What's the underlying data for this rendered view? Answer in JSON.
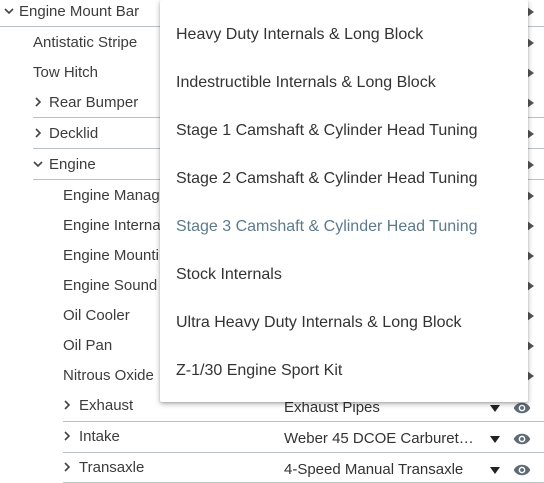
{
  "tree": {
    "rows": [
      {
        "label": "Engine Mount Bar"
      },
      {
        "label": "Antistatic Stripe"
      },
      {
        "label": "Tow Hitch"
      },
      {
        "label": "Rear Bumper"
      },
      {
        "label": "Decklid"
      },
      {
        "label": "Engine"
      },
      {
        "label": "Engine Manag"
      },
      {
        "label": "Engine Interna"
      },
      {
        "label": "Engine Mounti"
      },
      {
        "label": "Engine Sound"
      },
      {
        "label": "Oil Cooler"
      },
      {
        "label": "Oil Pan"
      },
      {
        "label": "Nitrous Oxide"
      }
    ],
    "sub_rows": [
      {
        "label": "Exhaust",
        "value": "Exhaust Pipes"
      },
      {
        "label": "Intake",
        "value": "Weber 45 DCOE Carburet…"
      },
      {
        "label": "Transaxle",
        "value": "4-Speed Manual Transaxle"
      }
    ]
  },
  "dropdown": {
    "options": [
      "Heavy Duty Internals & Long Block",
      "Indestructible Internals & Long Block",
      "Stage 1 Camshaft & Cylinder Head Tuning",
      "Stage 2 Camshaft & Cylinder Head Tuning",
      "Stage 3 Camshaft & Cylinder Head Tuning",
      "Stock Internals",
      "Ultra Heavy Duty Internals & Long Block",
      "Z-1/30 Engine Sport Kit"
    ],
    "selected": "Stage 3 Camshaft & Cylinder Head Tuning"
  },
  "icons": {
    "expanded": "chevron-down-icon",
    "collapsed": "chevron-right-icon",
    "visibility": "eye-icon",
    "submenu": "arrow-right-icon"
  },
  "colors": {
    "selected_option": "#5c7a8c",
    "underline": "#b9c0c7",
    "eye": "#5f6b74"
  }
}
